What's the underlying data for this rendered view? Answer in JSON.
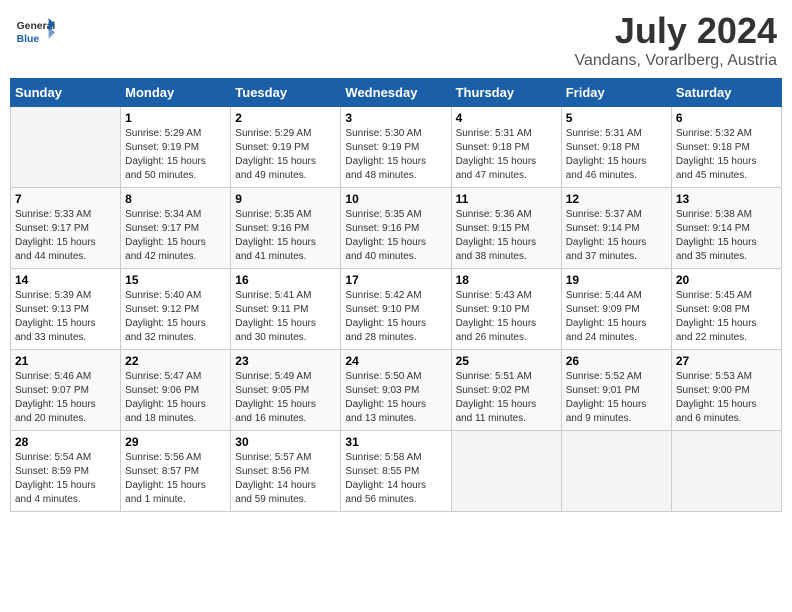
{
  "header": {
    "logo_general": "General",
    "logo_blue": "Blue",
    "title": "July 2024",
    "subtitle": "Vandans, Vorarlberg, Austria"
  },
  "calendar": {
    "columns": [
      "Sunday",
      "Monday",
      "Tuesday",
      "Wednesday",
      "Thursday",
      "Friday",
      "Saturday"
    ],
    "weeks": [
      [
        {
          "day": "",
          "info": ""
        },
        {
          "day": "1",
          "info": "Sunrise: 5:29 AM\nSunset: 9:19 PM\nDaylight: 15 hours\nand 50 minutes."
        },
        {
          "day": "2",
          "info": "Sunrise: 5:29 AM\nSunset: 9:19 PM\nDaylight: 15 hours\nand 49 minutes."
        },
        {
          "day": "3",
          "info": "Sunrise: 5:30 AM\nSunset: 9:19 PM\nDaylight: 15 hours\nand 48 minutes."
        },
        {
          "day": "4",
          "info": "Sunrise: 5:31 AM\nSunset: 9:18 PM\nDaylight: 15 hours\nand 47 minutes."
        },
        {
          "day": "5",
          "info": "Sunrise: 5:31 AM\nSunset: 9:18 PM\nDaylight: 15 hours\nand 46 minutes."
        },
        {
          "day": "6",
          "info": "Sunrise: 5:32 AM\nSunset: 9:18 PM\nDaylight: 15 hours\nand 45 minutes."
        }
      ],
      [
        {
          "day": "7",
          "info": "Sunrise: 5:33 AM\nSunset: 9:17 PM\nDaylight: 15 hours\nand 44 minutes."
        },
        {
          "day": "8",
          "info": "Sunrise: 5:34 AM\nSunset: 9:17 PM\nDaylight: 15 hours\nand 42 minutes."
        },
        {
          "day": "9",
          "info": "Sunrise: 5:35 AM\nSunset: 9:16 PM\nDaylight: 15 hours\nand 41 minutes."
        },
        {
          "day": "10",
          "info": "Sunrise: 5:35 AM\nSunset: 9:16 PM\nDaylight: 15 hours\nand 40 minutes."
        },
        {
          "day": "11",
          "info": "Sunrise: 5:36 AM\nSunset: 9:15 PM\nDaylight: 15 hours\nand 38 minutes."
        },
        {
          "day": "12",
          "info": "Sunrise: 5:37 AM\nSunset: 9:14 PM\nDaylight: 15 hours\nand 37 minutes."
        },
        {
          "day": "13",
          "info": "Sunrise: 5:38 AM\nSunset: 9:14 PM\nDaylight: 15 hours\nand 35 minutes."
        }
      ],
      [
        {
          "day": "14",
          "info": "Sunrise: 5:39 AM\nSunset: 9:13 PM\nDaylight: 15 hours\nand 33 minutes."
        },
        {
          "day": "15",
          "info": "Sunrise: 5:40 AM\nSunset: 9:12 PM\nDaylight: 15 hours\nand 32 minutes."
        },
        {
          "day": "16",
          "info": "Sunrise: 5:41 AM\nSunset: 9:11 PM\nDaylight: 15 hours\nand 30 minutes."
        },
        {
          "day": "17",
          "info": "Sunrise: 5:42 AM\nSunset: 9:10 PM\nDaylight: 15 hours\nand 28 minutes."
        },
        {
          "day": "18",
          "info": "Sunrise: 5:43 AM\nSunset: 9:10 PM\nDaylight: 15 hours\nand 26 minutes."
        },
        {
          "day": "19",
          "info": "Sunrise: 5:44 AM\nSunset: 9:09 PM\nDaylight: 15 hours\nand 24 minutes."
        },
        {
          "day": "20",
          "info": "Sunrise: 5:45 AM\nSunset: 9:08 PM\nDaylight: 15 hours\nand 22 minutes."
        }
      ],
      [
        {
          "day": "21",
          "info": "Sunrise: 5:46 AM\nSunset: 9:07 PM\nDaylight: 15 hours\nand 20 minutes."
        },
        {
          "day": "22",
          "info": "Sunrise: 5:47 AM\nSunset: 9:06 PM\nDaylight: 15 hours\nand 18 minutes."
        },
        {
          "day": "23",
          "info": "Sunrise: 5:49 AM\nSunset: 9:05 PM\nDaylight: 15 hours\nand 16 minutes."
        },
        {
          "day": "24",
          "info": "Sunrise: 5:50 AM\nSunset: 9:03 PM\nDaylight: 15 hours\nand 13 minutes."
        },
        {
          "day": "25",
          "info": "Sunrise: 5:51 AM\nSunset: 9:02 PM\nDaylight: 15 hours\nand 11 minutes."
        },
        {
          "day": "26",
          "info": "Sunrise: 5:52 AM\nSunset: 9:01 PM\nDaylight: 15 hours\nand 9 minutes."
        },
        {
          "day": "27",
          "info": "Sunrise: 5:53 AM\nSunset: 9:00 PM\nDaylight: 15 hours\nand 6 minutes."
        }
      ],
      [
        {
          "day": "28",
          "info": "Sunrise: 5:54 AM\nSunset: 8:59 PM\nDaylight: 15 hours\nand 4 minutes."
        },
        {
          "day": "29",
          "info": "Sunrise: 5:56 AM\nSunset: 8:57 PM\nDaylight: 15 hours\nand 1 minute."
        },
        {
          "day": "30",
          "info": "Sunrise: 5:57 AM\nSunset: 8:56 PM\nDaylight: 14 hours\nand 59 minutes."
        },
        {
          "day": "31",
          "info": "Sunrise: 5:58 AM\nSunset: 8:55 PM\nDaylight: 14 hours\nand 56 minutes."
        },
        {
          "day": "",
          "info": ""
        },
        {
          "day": "",
          "info": ""
        },
        {
          "day": "",
          "info": ""
        }
      ]
    ]
  }
}
